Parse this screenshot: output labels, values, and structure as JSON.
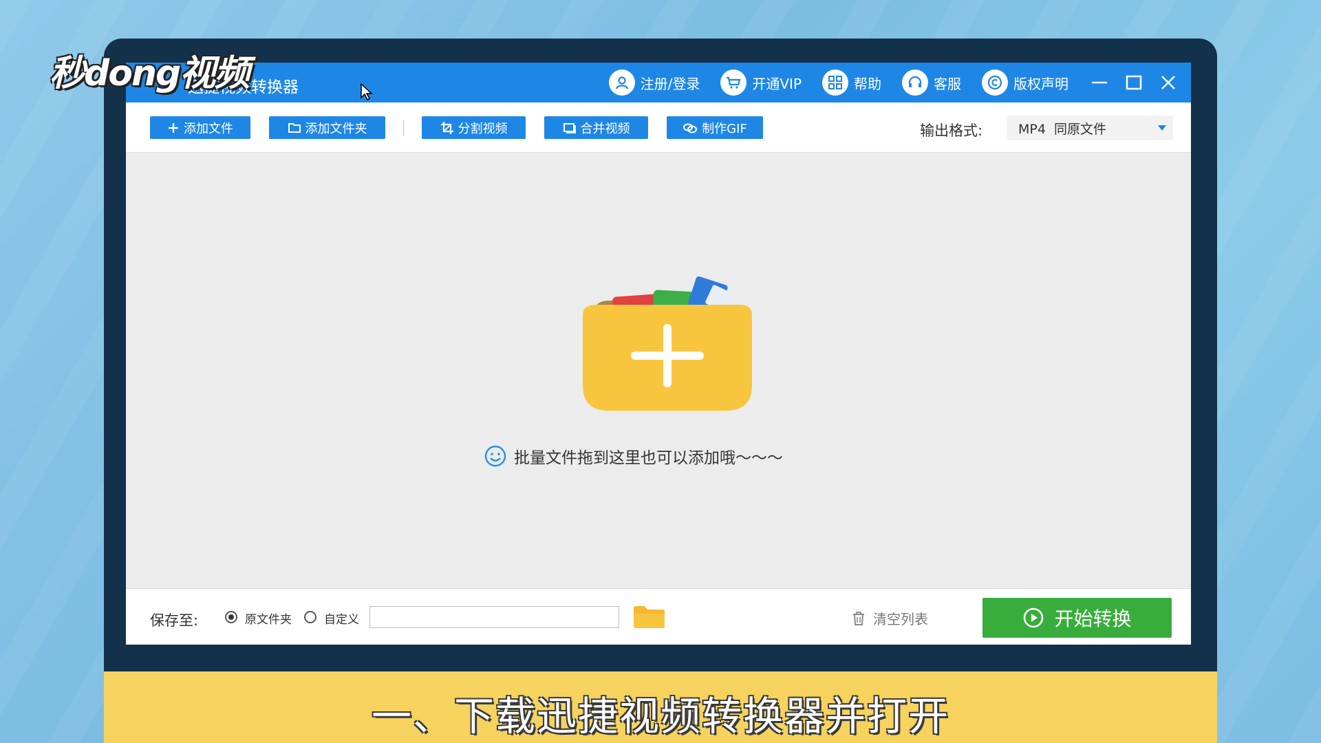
{
  "watermark": "秒dong视频",
  "app": {
    "title": "迅捷视频转换器",
    "nav": [
      {
        "icon": "user-icon",
        "label": "注册/登录"
      },
      {
        "icon": "cart-icon",
        "label": "开通VIP"
      },
      {
        "icon": "grid-icon",
        "label": "帮助"
      },
      {
        "icon": "headset-icon",
        "label": "客服"
      },
      {
        "icon": "copyright-icon",
        "label": "版权声明"
      }
    ]
  },
  "toolbar": {
    "add_file": "添加文件",
    "add_folder": "添加文件夹",
    "split_video": "分割视频",
    "merge_video": "合并视频",
    "make_gif": "制作GIF",
    "output_format_label": "输出格式:",
    "output_format_value": "MP4  同原文件"
  },
  "drop_zone": {
    "hint": "批量文件拖到这里也可以添加哦～～～"
  },
  "bottom": {
    "save_to_label": "保存至:",
    "option_original": "原文件夹",
    "option_custom": "自定义",
    "path_value": "",
    "clear_list": "清空列表",
    "start_convert": "开始转换"
  },
  "caption": "一、下载迅捷视频转换器并打开",
  "colors": {
    "brand_blue": "#1e87e6",
    "start_green": "#38ad3c",
    "caption_yellow": "#f6d25e",
    "folder_yellow": "#f8c63e"
  }
}
